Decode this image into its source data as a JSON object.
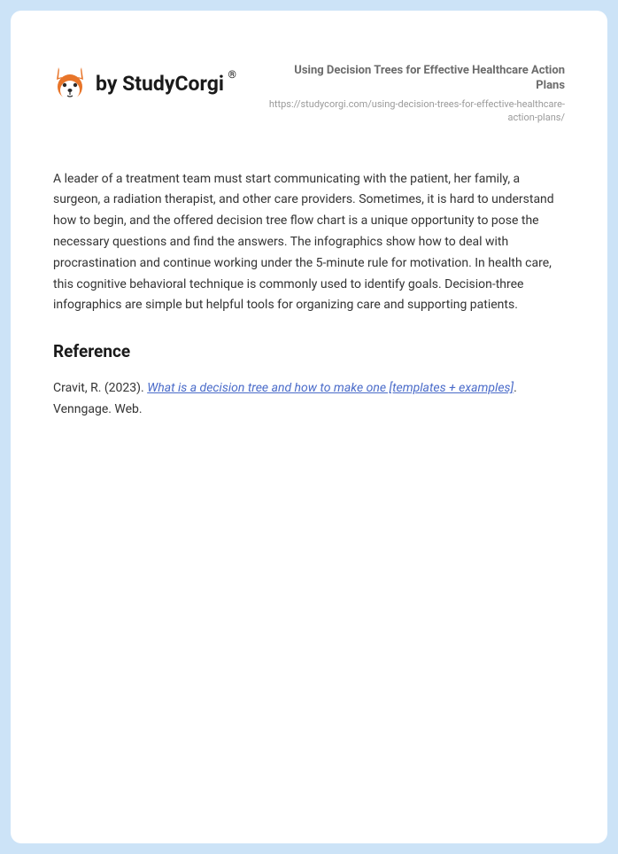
{
  "brand": {
    "text": "by StudyCorgi",
    "registered": "®"
  },
  "document": {
    "title": "Using Decision Trees for Effective Healthcare Action Plans",
    "url": "https://studycorgi.com/using-decision-trees-for-effective-healthcare-action-plans/"
  },
  "body": {
    "paragraph": "A leader of a treatment team must start communicating with the patient, her family, a surgeon, a radiation therapist, and other care providers. Sometimes, it is hard to understand how to begin, and the offered decision tree flow chart is a unique opportunity to pose the necessary questions and find the answers. The infographics show how to deal with procrastination and continue working under the 5-minute rule for motivation. In health care, this cognitive behavioral technique is commonly used to identify goals. Decision-three infographics are simple but helpful tools for organizing care and supporting patients."
  },
  "reference": {
    "heading": "Reference",
    "author_year": "Cravit, R. (2023). ",
    "link_text": "What is a decision tree and how to make one [templates + examples]",
    "suffix": ". Venngage. Web."
  }
}
